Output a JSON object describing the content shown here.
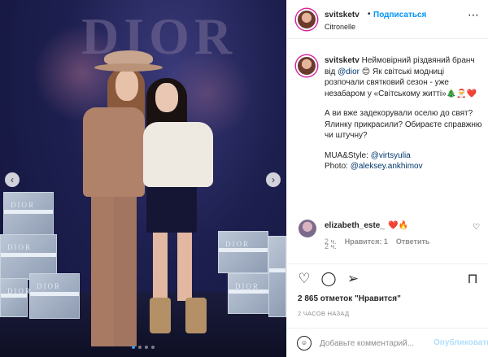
{
  "photo": {
    "logo_text": "DIOR",
    "box_label": "DIOR",
    "prev_arrow": "‹",
    "next_arrow": "›",
    "carousel_dots": 4,
    "active_dot": 0
  },
  "header": {
    "username": "svitsketv",
    "separator": "•",
    "follow_label": "Подписаться",
    "location": "Citronelle",
    "more_icon": "⋯"
  },
  "caption": {
    "username": "svitsketv",
    "line1": " Неймовірний різдвяний бранч від ",
    "mention_brand": "@dior",
    "line1_rest": " 😊 Як світські модниці розпочали святковий сезон - уже незабаром у «Світському житті»🎄🎅❤️",
    "para2": "А ви вже задекорували оселю до свят? Ялинку прикрасили? Обираєте справжню чи штучну?",
    "mua_label": "MUA&Style: ",
    "mua_handle": "@virtsyulia",
    "photo_label": "Photo: ",
    "photo_handle": "@aleksey.ankhimov",
    "time": "2 ч."
  },
  "comment": {
    "username": "elizabeth_este_",
    "text": "❤️🔥",
    "time": "2 ч.",
    "like_label": "Нравится: 1",
    "reply_label": "Ответить",
    "heart_icon": "♡"
  },
  "actions": {
    "like_icon": "♡",
    "comment_icon": "◯",
    "share_icon": "➢",
    "save_icon": "⊓"
  },
  "likes_text": "2 865 отметок \"Нравится\"",
  "posted_text": "2 ЧАСОВ НАЗАД",
  "add_comment": {
    "emoji_icon": "☺",
    "placeholder": "Добавьте комментарий...",
    "publish_label": "Опубликовать"
  },
  "colors": {
    "accent": "#0095f6",
    "link": "#00376b",
    "muted": "#8e8e8e",
    "publish_disabled": "#b2dffc"
  }
}
